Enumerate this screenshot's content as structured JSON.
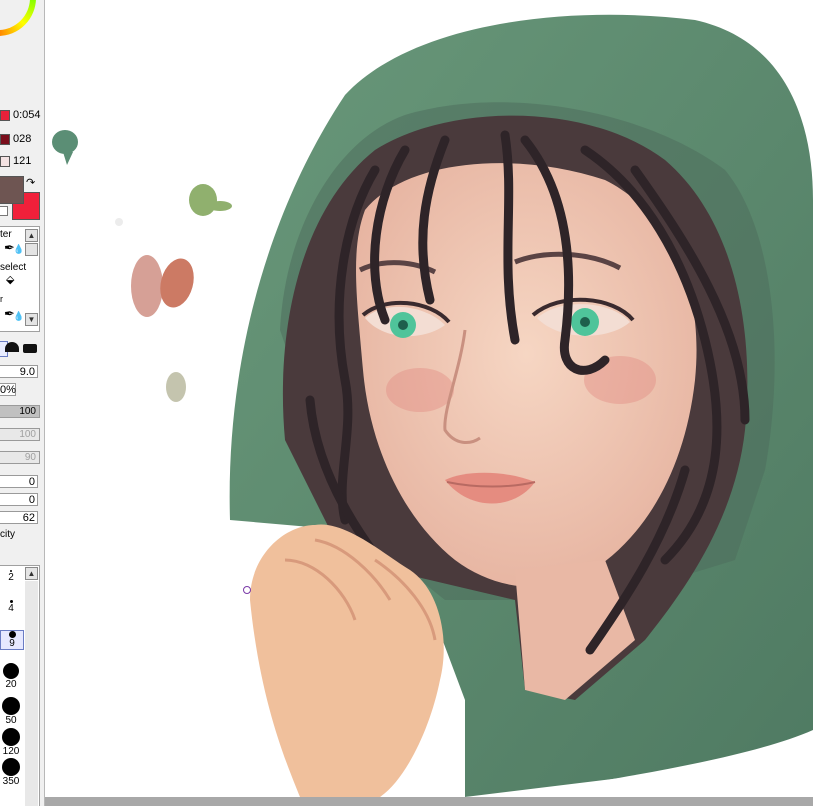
{
  "color_panel": {
    "sliders": [
      {
        "value": "0:054",
        "color": "#e8213a"
      },
      {
        "value": "028",
        "color": "#7a0e1c"
      },
      {
        "value": "121",
        "color": "#f4e3e3"
      }
    ],
    "primary_color": "#6e5552",
    "secondary_color": "#f0203a"
  },
  "tool_panel": {
    "tool_labels": [
      "ter",
      "select"
    ],
    "brush_size": "9.0",
    "density": "0%",
    "params": [
      "100",
      "100",
      "90"
    ],
    "offsets": [
      "0",
      "0"
    ],
    "blending": "62",
    "blending_label": "city"
  },
  "brush_sizes": [
    "2",
    "4",
    "9",
    "20",
    "50",
    "120",
    "350"
  ],
  "canvas": {
    "hood_color": "#5f8f6f",
    "hair_color": "#3a2a2e",
    "skin_color": "#f0c8b0",
    "eye_color": "#4fc49a"
  }
}
